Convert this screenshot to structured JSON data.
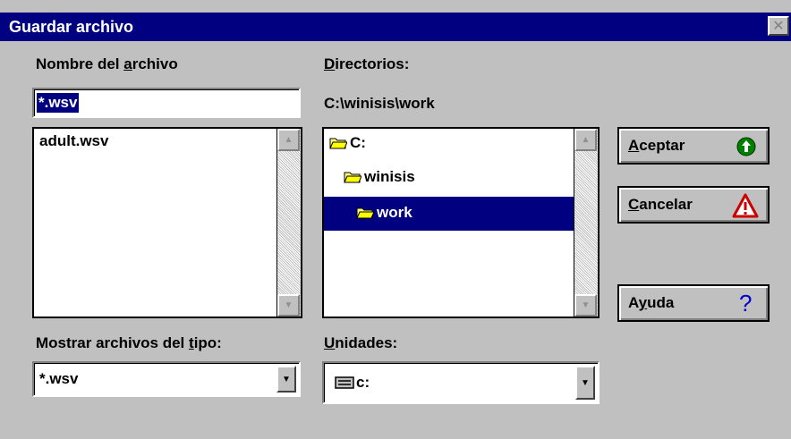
{
  "window": {
    "title": "Guardar archivo"
  },
  "filename": {
    "label_pre": "Nombre del ",
    "label_ul": "a",
    "label_post": "rchivo",
    "value": "*.wsv",
    "files": [
      "adult.wsv"
    ]
  },
  "directories": {
    "label_ul": "D",
    "label_post": "irectorios:",
    "current_path": "C:\\winisis\\work",
    "tree": [
      "C:",
      "winisis",
      "work"
    ],
    "selected": "work"
  },
  "filetype": {
    "label_pre": "Mostrar archivos del ",
    "label_ul": "t",
    "label_post": "ipo:",
    "value": "*.wsv"
  },
  "drives": {
    "label_ul": "U",
    "label_post": "nidades:",
    "value": "c:"
  },
  "buttons": {
    "accept_ul": "A",
    "accept_post": "ceptar",
    "cancel_ul": "C",
    "cancel_post": "ancelar",
    "help_pre": "A",
    "help_ul": "y",
    "help_post": "uda"
  },
  "icons": {
    "accept": "green-arrow-up-icon",
    "cancel": "red-warning-triangle-icon",
    "help": "blue-question-icon",
    "close": "close-icon",
    "drive": "drive-icon",
    "folder": "folder-icon"
  },
  "colors": {
    "titlebar": "#000080",
    "face": "#c0c0c0",
    "selection": "#000080",
    "accept_icon": "#008000",
    "cancel_icon": "#cc0000",
    "help_icon": "#0000cc"
  }
}
